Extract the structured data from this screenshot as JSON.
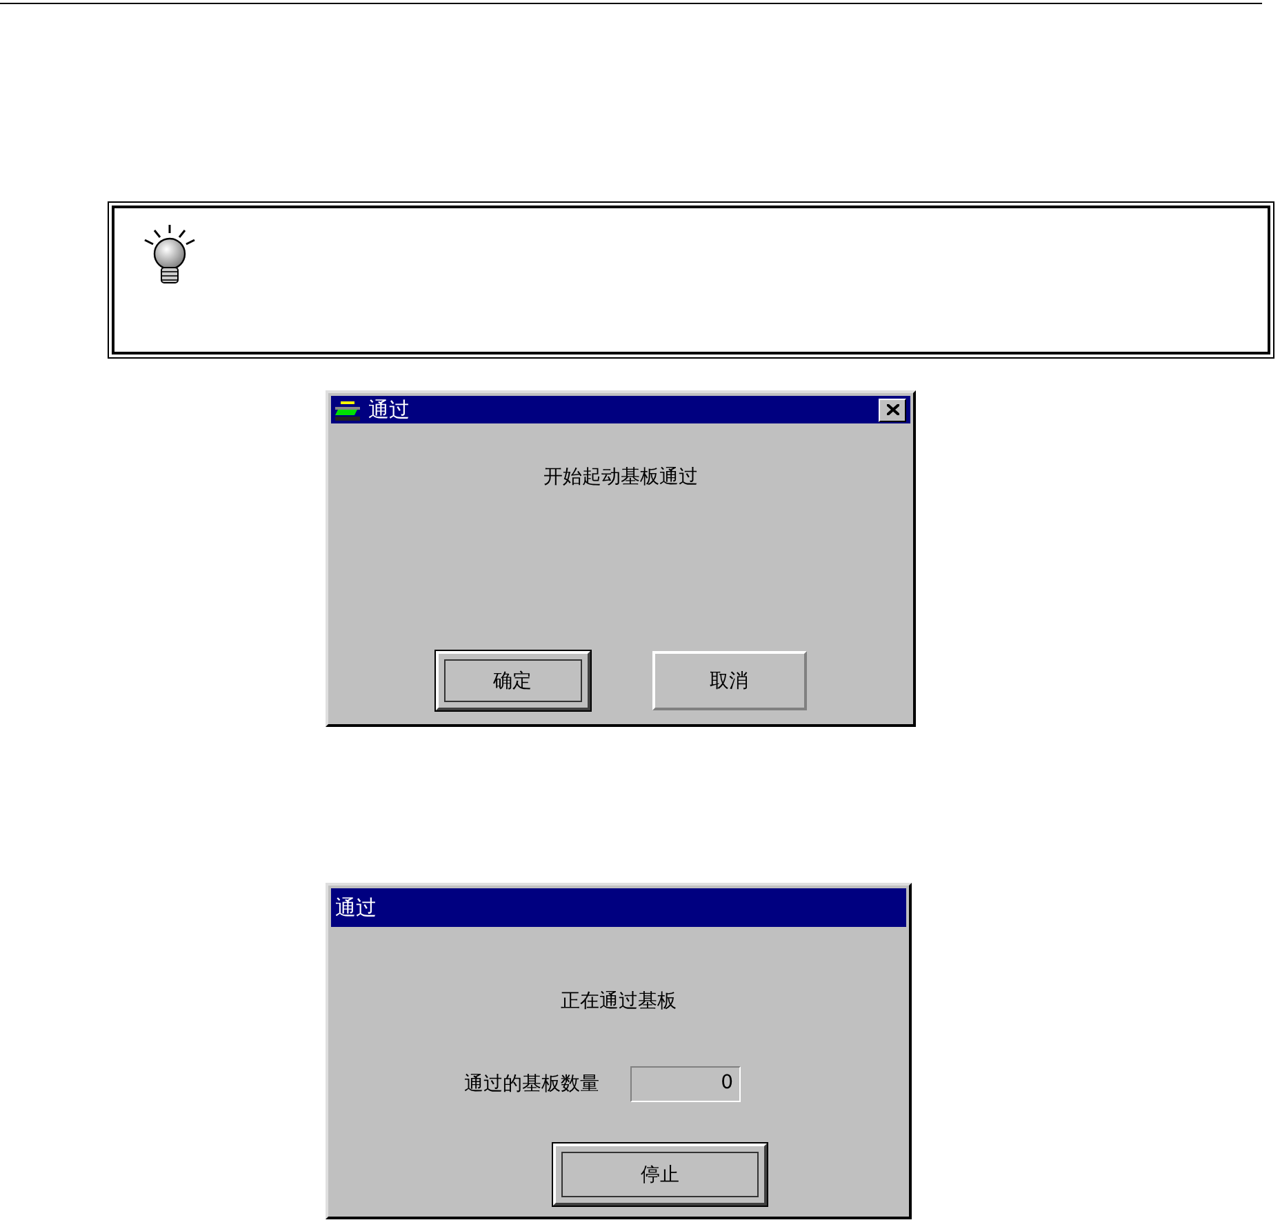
{
  "note": {
    "kind": "tip"
  },
  "dialogs": [
    {
      "title": "通过",
      "app_icon": true,
      "close_button": true,
      "message": "开始起动基板通过",
      "buttons": [
        {
          "label": "确定",
          "default": true
        },
        {
          "label": "取消",
          "default": false
        }
      ]
    },
    {
      "title": "通过",
      "app_icon": false,
      "close_button": false,
      "message": "正在通过基板",
      "counter": {
        "label": "通过的基板数量",
        "value": "0"
      },
      "buttons": [
        {
          "label": "停止",
          "default": true
        }
      ]
    }
  ]
}
